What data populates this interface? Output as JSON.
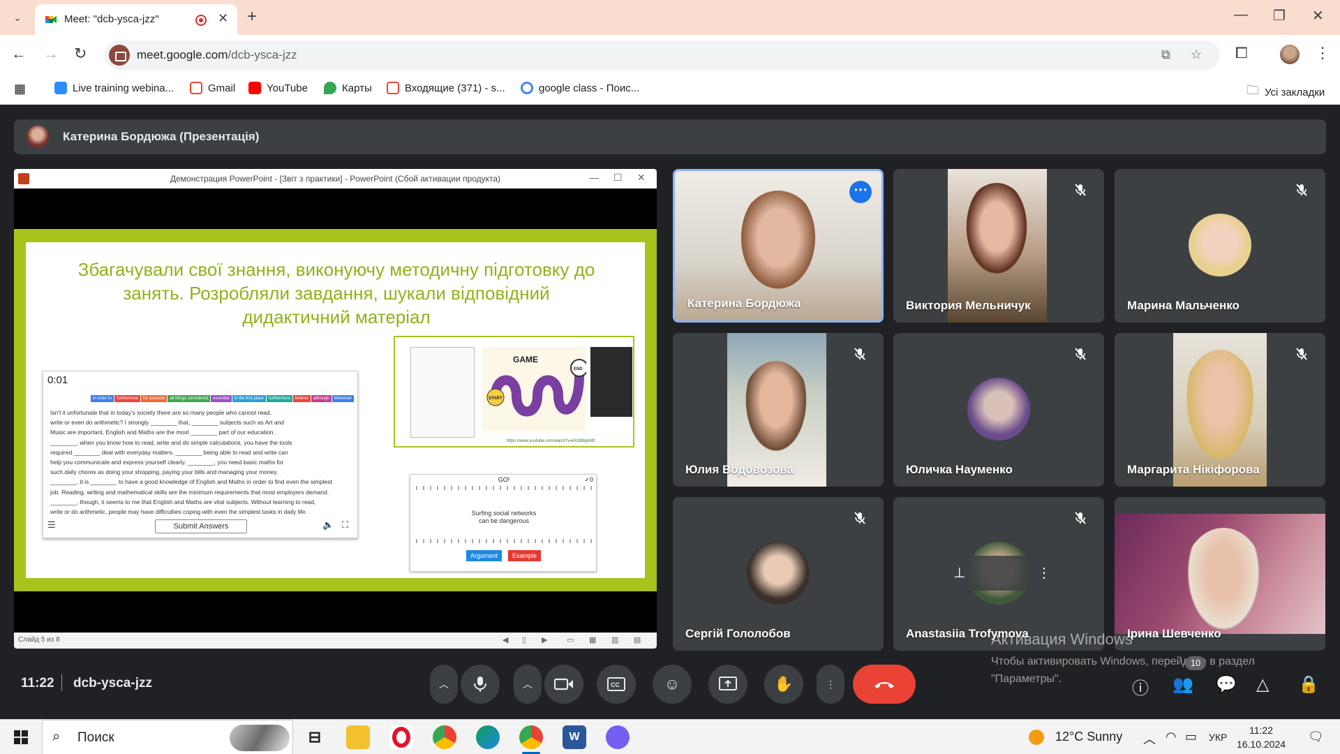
{
  "browser": {
    "tab_title": "Meet: \"dcb-ysca-jzz\"",
    "url_host": "meet.google.com",
    "url_path": "/dcb-ysca-jzz",
    "bookmarks": [
      {
        "label": "Live training webina...",
        "icon": "zoom-icon",
        "color": "#2d8cff"
      },
      {
        "label": "Gmail",
        "icon": "gmail-icon",
        "color": "#ea4335"
      },
      {
        "label": "YouTube",
        "icon": "youtube-icon",
        "color": "#ff0000"
      },
      {
        "label": "Карты",
        "icon": "maps-icon",
        "color": "#34a853"
      },
      {
        "label": "Входящие (371) - s...",
        "icon": "gmail-icon",
        "color": "#ea4335"
      },
      {
        "label": "google class - Поис...",
        "icon": "google-icon",
        "color": "#4285f4"
      }
    ],
    "all_bookmarks": "Усі закладки"
  },
  "meet": {
    "presenter_label": "Катерина Бордюжа (Презентація)",
    "ppt_window_title": "Демонстрация PowerPoint - [Звіт з практики] - PowerPoint (Сбой активации продукта)",
    "slide": {
      "heading": "Збагачували свої знання, виконуючу методичну підготовку до занять. Розробляли завдання, шукали відповідний дидактичний матеріал",
      "worksheet": {
        "timer": "0:01",
        "words": [
          "in order to",
          "furthermore",
          "for example",
          "all things considered",
          "essential",
          "in the first place",
          "furthermore",
          "believe",
          "although",
          "Moreover"
        ],
        "text_lines": [
          "Isn't it unfortunate that in today's society there are so many people who cannot read,",
          "write or even do arithmetic? I strongly ________ that, ________ subjects such as Art and",
          "Music are important, English and Maths are the most ________ part of our education.",
          "________, when you know how to read, write and do simple calculations, you have the tools",
          "required ________ deal with everyday matters. ________ being able to read and write can",
          "help you communicate and express yourself clearly. ________, you need basic maths for",
          "such daily chores as doing your shopping, paying your bills and managing your money.",
          "________, it is ________ to have a good knowledge of English and Maths in order to find even the simplest",
          "job. Reading, writing and mathematical skills are the minimum requirements that most employers demand.",
          "________, though, it seems to me that English and Maths are vital subjects. Without learning to read,",
          "write or do arithmetic, people may have difficulties coping with even the simplest tasks in daily life."
        ],
        "submit_label": "Submit Answers"
      },
      "game": {
        "board_title": "GAME",
        "start": "START",
        "end": "END",
        "link": "https://www.youtube.com/watch?v=kXzBBpkM0"
      },
      "argument_game": {
        "go": "GO!",
        "score": "✓0",
        "statement_line1": "Surfing social networks",
        "statement_line2": "can be dangerous",
        "argument_label": "Argument",
        "example_label": "Example"
      }
    },
    "ppt_status": "Слайд 5 из 8",
    "participants": [
      {
        "name": "Катерина Бордюжа",
        "muted": false,
        "active": true
      },
      {
        "name": "Виктория Мельничук",
        "muted": true
      },
      {
        "name": "Марина Мальченко",
        "muted": true
      },
      {
        "name": "Юлия Водовозова",
        "muted": true
      },
      {
        "name": "Юличка Науменко",
        "muted": true
      },
      {
        "name": "Маргарита Нікіфорова",
        "muted": true
      },
      {
        "name": "Сергій Гололобов",
        "muted": true
      },
      {
        "name": "Anastasiia Trofymova",
        "muted": true
      },
      {
        "name": "Ірина Шевченко",
        "muted": false
      }
    ],
    "time": "11:22",
    "meeting_code": "dcb-ysca-jzz",
    "people_count": "10",
    "colors": {
      "end_call": "#ea4335",
      "active_border": "#8ab4f8",
      "slide_accent": "#a8c41c"
    }
  },
  "windows": {
    "activation_title": "Активация Windows",
    "activation_text": "Чтобы активировать Windows, перейдите в раздел \"Параметры\".",
    "search_placeholder": "Поиск",
    "weather": "12°C  Sunny",
    "language": "УКР",
    "clock_time": "11:22",
    "clock_date": "16.10.2024"
  }
}
